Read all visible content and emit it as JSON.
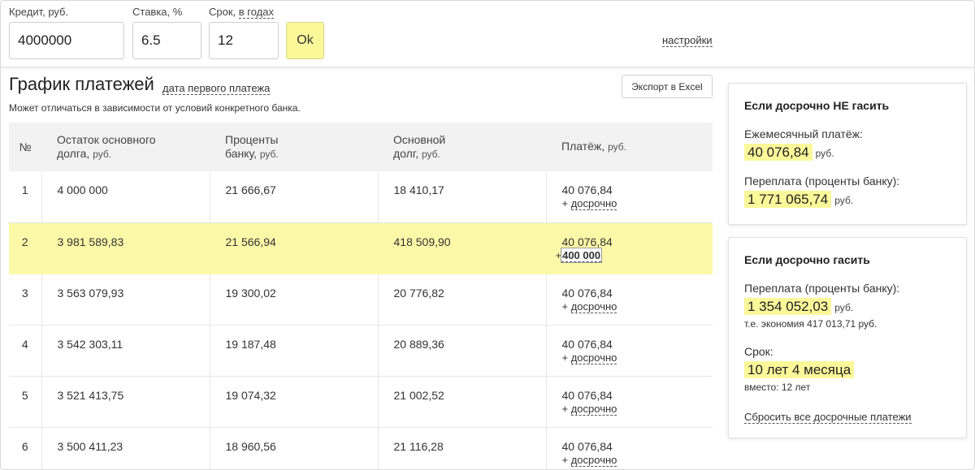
{
  "form": {
    "credit_label": "Кредит, руб.",
    "credit_value": "4000000",
    "rate_label": "Ставка, %",
    "rate_value": "6.5",
    "term_label_prefix": "Срок, ",
    "term_label_link": "в годах",
    "term_value": "12",
    "ok_label": "Ok",
    "settings_label": "настройки"
  },
  "schedule": {
    "title": "График платежей",
    "first_date_link": "дата первого платежа",
    "note": "Может отличаться в зависимости от условий конкретного банка.",
    "export_label": "Экспорт в Excel",
    "columns": [
      {
        "line1": "№",
        "line2": "",
        "unit": ""
      },
      {
        "line1": "Остаток основного",
        "line2": "долга, ",
        "unit": "руб."
      },
      {
        "line1": "Проценты",
        "line2": "банку, ",
        "unit": "руб."
      },
      {
        "line1": "Основной",
        "line2": "долг, ",
        "unit": "руб."
      },
      {
        "line1": "",
        "line2": "Платёж, ",
        "unit": "руб."
      }
    ],
    "early_link": "досрочно",
    "plus": "+",
    "rows": [
      {
        "n": "1",
        "remaining": "4 000 000",
        "interest": "21 666,67",
        "principal": "18 410,17",
        "payment": "40 076,84",
        "early_amount": ""
      },
      {
        "n": "2",
        "remaining": "3 981 589,83",
        "interest": "21 566,94",
        "principal": "418 509,90",
        "payment": "40 076,84",
        "early_amount": "400 000"
      },
      {
        "n": "3",
        "remaining": "3 563 079,93",
        "interest": "19 300,02",
        "principal": "20 776,82",
        "payment": "40 076,84",
        "early_amount": ""
      },
      {
        "n": "4",
        "remaining": "3 542 303,11",
        "interest": "19 187,48",
        "principal": "20 889,36",
        "payment": "40 076,84",
        "early_amount": ""
      },
      {
        "n": "5",
        "remaining": "3 521 413,75",
        "interest": "19 074,32",
        "principal": "21 002,52",
        "payment": "40 076,84",
        "early_amount": ""
      },
      {
        "n": "6",
        "remaining": "3 500 411,23",
        "interest": "18 960,56",
        "principal": "21 116,28",
        "payment": "40 076,84",
        "early_amount": ""
      }
    ]
  },
  "no_early": {
    "title": "Если досрочно НЕ гасить",
    "monthly_label": "Ежемесячный платёж:",
    "monthly_value": "40 076,84",
    "monthly_unit": "руб.",
    "overpay_label": "Переплата (проценты банку):",
    "overpay_value": "1 771 065,74",
    "overpay_unit": "руб."
  },
  "with_early": {
    "title": "Если досрочно гасить",
    "overpay_label": "Переплата (проценты банку):",
    "overpay_value": "1 354 052,03",
    "overpay_unit": "руб.",
    "savings_note": "т.е. экономия 417 013,71 руб.",
    "term_label": "Срок:",
    "term_value": "10 лет 4 месяца",
    "term_note": "вместо: 12 лет",
    "reset_label": "Сбросить все досрочные платежи"
  },
  "colors": {
    "highlight": "#fbf89a",
    "row_highlight": "#fbf9a8",
    "header_bg": "#f2f2f2"
  }
}
